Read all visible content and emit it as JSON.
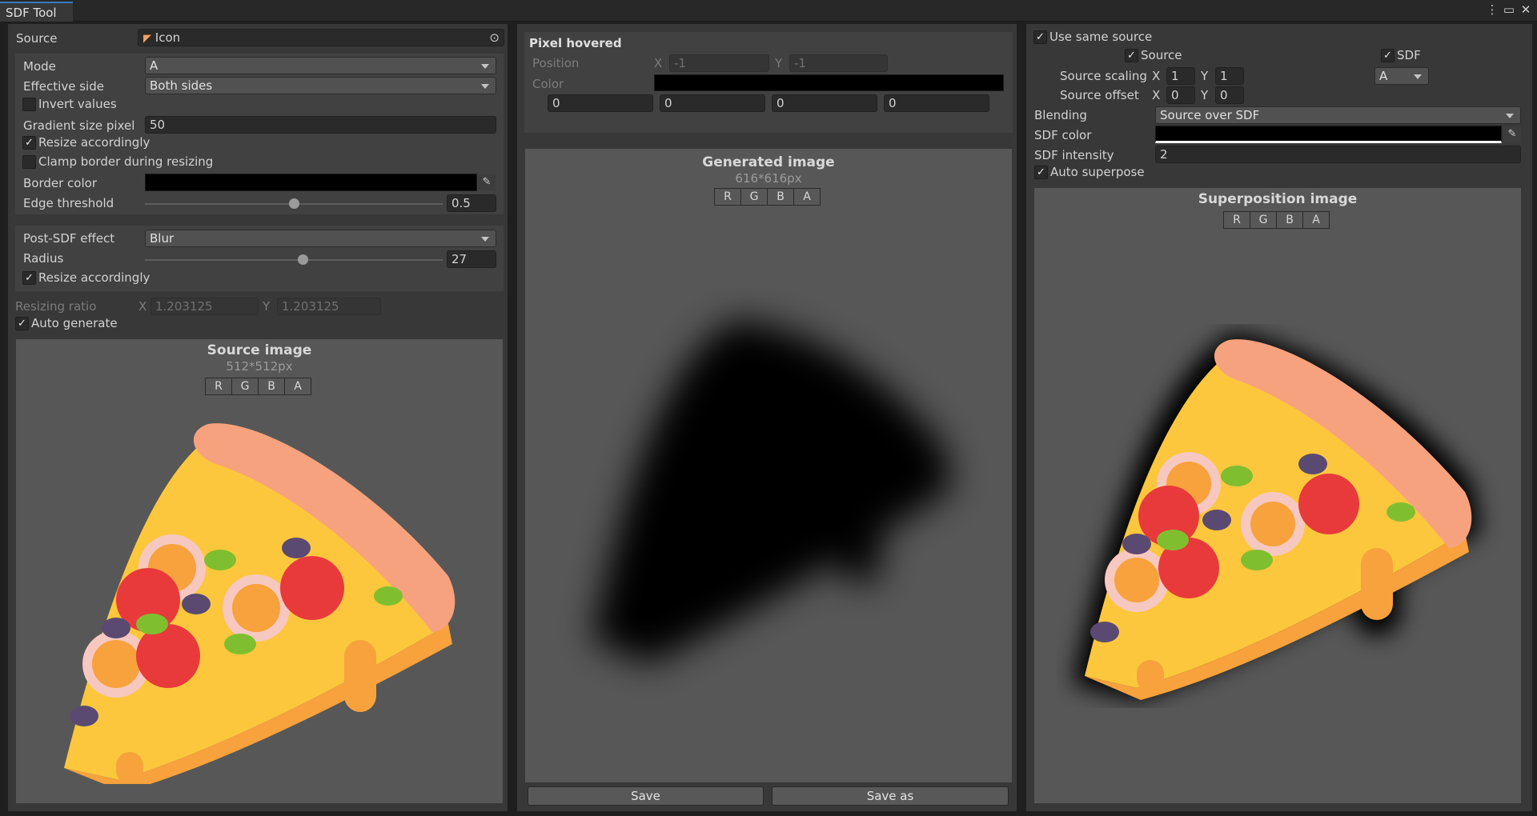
{
  "window": {
    "tab_title": "SDF Tool",
    "menu_icon": "kebab-menu-icon",
    "maximize_icon": "maximize-icon",
    "close_icon": "close-icon"
  },
  "left": {
    "source_label": "Source",
    "source_value": "Icon",
    "mode_label": "Mode",
    "mode_value": "A",
    "effective_side_label": "Effective side",
    "effective_side_value": "Both sides",
    "invert_label": "Invert values",
    "invert_checked": false,
    "gradient_label": "Gradient size pixel",
    "gradient_value": "50",
    "resize_label": "Resize accordingly",
    "resize_checked": true,
    "clamp_label": "Clamp border during resizing",
    "clamp_checked": false,
    "border_color_label": "Border color",
    "border_color": "#000000",
    "edge_label": "Edge threshold",
    "edge_value": "0.5",
    "edge_fraction": 0.5,
    "post_label": "Post-SDF effect",
    "post_value": "Blur",
    "radius_label": "Radius",
    "radius_value": "27",
    "radius_fraction": 0.53,
    "post_resize_label": "Resize accordingly",
    "post_resize_checked": true,
    "ratio_label": "Resizing ratio",
    "ratio_x_label": "X",
    "ratio_x": "1.203125",
    "ratio_y_label": "Y",
    "ratio_y": "1.203125",
    "auto_generate_label": "Auto generate",
    "auto_generate_checked": true,
    "image_title": "Source image",
    "image_size": "512*512px",
    "channels": [
      "R",
      "G",
      "B",
      "A"
    ]
  },
  "middle": {
    "hover_title": "Pixel hovered",
    "position_label": "Position",
    "pos_x_label": "X",
    "pos_x": "-1",
    "pos_y_label": "Y",
    "pos_y": "-1",
    "color_label": "Color",
    "color_swatch": "#000000",
    "color_values": [
      "0",
      "0",
      "0",
      "0"
    ],
    "image_title": "Generated image",
    "image_size": "616*616px",
    "channels": [
      "R",
      "G",
      "B",
      "A"
    ],
    "save_label": "Save",
    "save_as_label": "Save as"
  },
  "right": {
    "use_same_label": "Use same source",
    "use_same_checked": true,
    "source_label": "Source",
    "source_checked": true,
    "sdf_label": "SDF",
    "sdf_checked": true,
    "scaling_label": "Source scaling",
    "scaling_x_label": "X",
    "scaling_x": "1",
    "scaling_y_label": "Y",
    "scaling_y": "1",
    "channel_select": "A",
    "offset_label": "Source offset",
    "offset_x_label": "X",
    "offset_x": "0",
    "offset_y_label": "Y",
    "offset_y": "0",
    "blending_label": "Blending",
    "blending_value": "Source over SDF",
    "sdf_color_label": "SDF color",
    "sdf_color": "#000000",
    "sdf_intensity_label": "SDF intensity",
    "sdf_intensity": "2",
    "auto_superpose_label": "Auto superpose",
    "auto_superpose_checked": true,
    "image_title": "Superposition image",
    "channels": [
      "R",
      "G",
      "B",
      "A"
    ]
  },
  "colors": {
    "accent": "#3a79bb",
    "crust": "#f7a27e",
    "cheese": "#fcc73d",
    "tomato": "#e83a3a",
    "olive": "#5a4a72",
    "pepper": "#7fbf2f",
    "onion": "#f7c8c0"
  }
}
